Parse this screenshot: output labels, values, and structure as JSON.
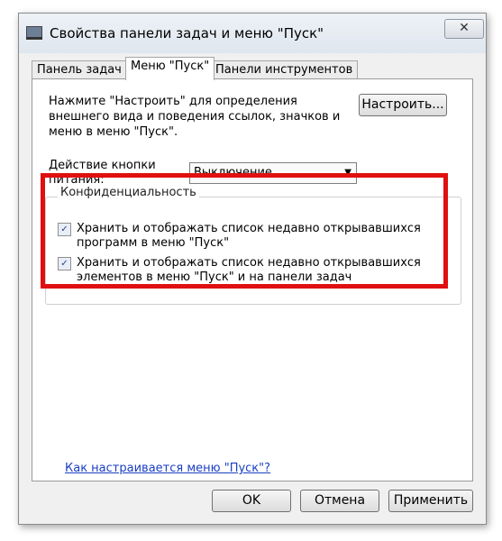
{
  "window": {
    "title": "Свойства панели задач и меню \"Пуск\"",
    "close_glyph": "✕",
    "app_icon": "taskbar-icon"
  },
  "tabs": [
    {
      "label": "Панель задач"
    },
    {
      "label": "Меню \"Пуск\""
    },
    {
      "label": "Панели инструментов"
    }
  ],
  "start_menu": {
    "description": "Нажмите \"Настроить\" для определения внешнего вида и поведения ссылок, значков и меню в меню \"Пуск\".",
    "customize_button": "Настроить...",
    "power_label": "Действие кнопки питания:",
    "power_value": "Выключение"
  },
  "privacy": {
    "title": "Конфиденциальность",
    "options": [
      {
        "label": "Хранить и отображать список недавно открывавшихся программ в меню \"Пуск\"",
        "checked": true
      },
      {
        "label": "Хранить и отображать список недавно открывавшихся элементов в меню \"Пуск\" и на панели задач",
        "checked": true
      }
    ]
  },
  "help_link": "Как настраивается меню \"Пуск\"?",
  "buttons": {
    "ok": "OK",
    "cancel": "Отмена",
    "apply": "Применить"
  },
  "annotation": {
    "highlight_color": "#e01010"
  }
}
